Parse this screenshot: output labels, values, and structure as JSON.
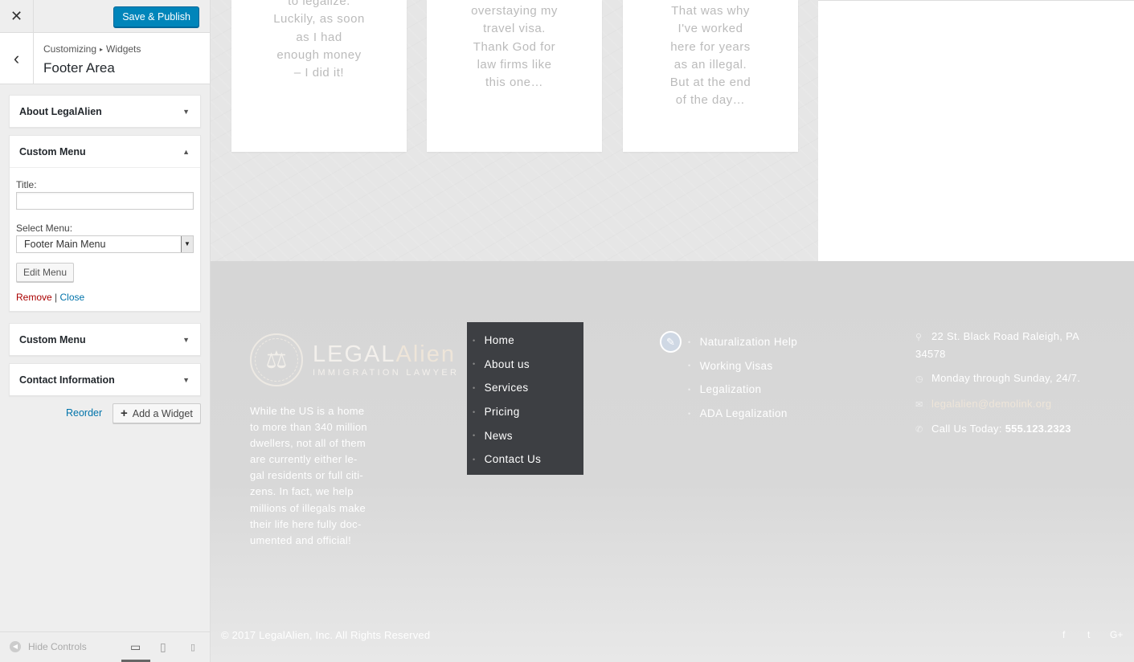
{
  "customizer": {
    "close_glyph": "✕",
    "save_label": "Save & Publish",
    "back_glyph": "‹",
    "breadcrumb_root": "Customizing",
    "breadcrumb_sep": "▸",
    "breadcrumb_current": "Widgets",
    "section_title": "Footer Area",
    "widgets": [
      {
        "title": "About LegalAlien",
        "caret": "▼"
      },
      {
        "title": "Custom Menu",
        "caret": "▲"
      },
      {
        "title": "Custom Menu",
        "caret": "▼"
      },
      {
        "title": "Contact Information",
        "caret": "▼"
      }
    ],
    "form": {
      "title_label": "Title:",
      "title_value": "",
      "select_label": "Select Menu:",
      "select_value": "Footer Main Menu",
      "select_arrow": "▼",
      "edit_menu_label": "Edit Menu",
      "remove_label": "Remove",
      "sep": "|",
      "close_label": "Close"
    },
    "reorder_label": "Reorder",
    "add_widget_plus": "+",
    "add_widget_label": "Add a Widget",
    "hide_controls_label": "Hide Controls",
    "hide_controls_glyph": "◀",
    "devices": {
      "desktop": "▭",
      "tablet": "▯",
      "mobile": "▯",
      "active": "desktop"
    }
  },
  "preview": {
    "cards": [
      {
        "lines": [
          "to legalize.",
          "Luckily, as soon",
          "as I had",
          "enough money",
          "– I did it!"
        ]
      },
      {
        "lines": [
          "overstaying my",
          "travel visa.",
          "Thank God for",
          "law firms like",
          "this one…"
        ]
      },
      {
        "lines": [
          "That was why",
          "I've worked",
          "here for years",
          "as an illegal.",
          "But at the end",
          "of the day…"
        ]
      }
    ],
    "logo": {
      "emblem": "⚖",
      "main_a": "LEGAL",
      "main_b": "Alien",
      "sub": "IMMIGRATION LAWYER"
    },
    "about_lines": [
      "While the US is a home",
      "to more than 340 million",
      "dwellers, not all of them",
      "are currently either le-",
      "gal residents or full citi-",
      "zens. In fact, we help",
      "millions of illegals make",
      "their life here fully doc-",
      "umented and official!"
    ],
    "menu": [
      "Home",
      "About us",
      "Services",
      "Pricing",
      "News",
      "Contact Us"
    ],
    "bullet": "•",
    "pencil_glyph": "✎",
    "links": [
      "Naturalization Help",
      "Working Visas",
      "Legalization",
      "ADA Legalization"
    ],
    "contact": {
      "address_icon": "⚲",
      "address": "22 St. Black Road Raleigh, PA 34578",
      "hours_icon": "◷",
      "hours": "Monday through Sunday, 24/7.",
      "email_icon": "✉",
      "email": "legalalien@demolink.org",
      "phone_icon": "✆",
      "phone_prefix": "Call Us Today:",
      "phone": "555.123.2323"
    },
    "copyright": "© 2017 LegalAlien, Inc. All Rights Reserved",
    "social": [
      "f",
      "t",
      "G+"
    ]
  }
}
